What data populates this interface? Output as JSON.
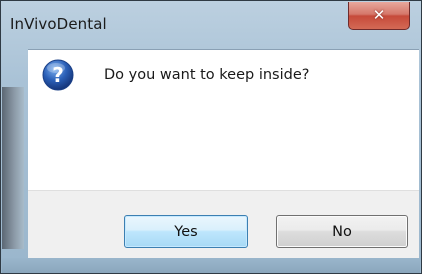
{
  "window": {
    "title": "InVivoDental",
    "close_icon": "close-icon"
  },
  "dialog": {
    "icon": "question-icon",
    "message": "Do you want to keep inside?",
    "buttons": {
      "yes_label": "Yes",
      "no_label": "No"
    }
  },
  "colors": {
    "frame": "#a9c2d6",
    "close_button": "#c64a3a",
    "default_button_border": "#3c7fb1",
    "question_icon": "#2a5fb7"
  }
}
